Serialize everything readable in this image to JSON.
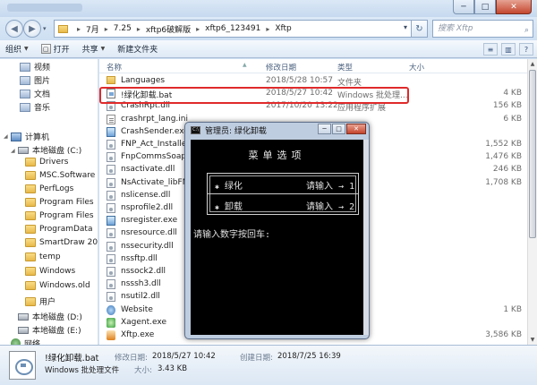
{
  "window": {
    "controls": {
      "minimize": "─",
      "maximize": "□",
      "close": "✕"
    }
  },
  "nav": {
    "back": "◀",
    "forward": "▶",
    "dropdown": "▾",
    "refresh": "↻"
  },
  "address": {
    "segments": [
      "7月",
      "7.25",
      "xftp6破解版",
      "xftp6_123491",
      "Xftp"
    ],
    "separator": "▸",
    "history": "▾"
  },
  "search": {
    "placeholder": "搜索 Xftp",
    "icon": "search-icon"
  },
  "toolbar": {
    "organize": "组织",
    "open": "打开",
    "share": "共享",
    "new_folder": "新建文件夹",
    "view_btn": "≡",
    "pane_btn": "▥",
    "help_btn": "?"
  },
  "sidebar": {
    "items": [
      {
        "label": "视频",
        "icon": "folder-icon"
      },
      {
        "label": "图片",
        "icon": "folder-icon"
      },
      {
        "label": "文档",
        "icon": "folder-icon"
      },
      {
        "label": "音乐",
        "icon": "folder-icon"
      },
      {
        "label": "计算机",
        "icon": "computer-icon"
      },
      {
        "label": "本地磁盘 (C:)",
        "icon": "drive-icon"
      },
      {
        "label": "Drivers",
        "icon": "folder-icon"
      },
      {
        "label": "MSC.Software",
        "icon": "folder-icon"
      },
      {
        "label": "PerfLogs",
        "icon": "folder-icon"
      },
      {
        "label": "Program Files",
        "icon": "folder-icon"
      },
      {
        "label": "Program Files",
        "icon": "folder-icon"
      },
      {
        "label": "ProgramData",
        "icon": "folder-icon"
      },
      {
        "label": "SmartDraw 20",
        "icon": "folder-icon"
      },
      {
        "label": "temp",
        "icon": "folder-icon"
      },
      {
        "label": "Windows",
        "icon": "folder-icon"
      },
      {
        "label": "Windows.old",
        "icon": "folder-icon"
      },
      {
        "label": "用户",
        "icon": "folder-icon"
      },
      {
        "label": "本地磁盘 (D:)",
        "icon": "drive-icon"
      },
      {
        "label": "本地磁盘 (E:)",
        "icon": "drive-icon"
      },
      {
        "label": "网络",
        "icon": "network-icon"
      }
    ]
  },
  "columns": {
    "name": "名称",
    "modified": "修改日期",
    "type": "类型",
    "size": "大小"
  },
  "files": [
    {
      "name": "Languages",
      "date": "2018/5/28 10:57",
      "type": "文件夹",
      "size": "",
      "icon": "folder"
    },
    {
      "name": "!绿化卸载.bat",
      "date": "2018/5/27 10:42",
      "type": "Windows 批处理...",
      "size": "4 KB",
      "icon": "bat"
    },
    {
      "name": "CrashRpt.dll",
      "date": "2017/10/20 13:22",
      "type": "应用程序扩展",
      "size": "156 KB",
      "icon": "dll"
    },
    {
      "name": "crashrpt_lang.ini",
      "date": "",
      "type": "",
      "size": "6 KB",
      "icon": "ini"
    },
    {
      "name": "CrashSender.exe",
      "date": "",
      "type": "",
      "size": "",
      "icon": "exe"
    },
    {
      "name": "FNP_Act_Installer.dl",
      "date": "",
      "type": "",
      "size": "1,552 KB",
      "icon": "dll"
    },
    {
      "name": "FnpCommsSoap.dll",
      "date": "",
      "type": "",
      "size": "1,476 KB",
      "icon": "dll"
    },
    {
      "name": "nsactivate.dll",
      "date": "",
      "type": "",
      "size": "246 KB",
      "icon": "dll"
    },
    {
      "name": "NsActivate_libFNP.d",
      "date": "",
      "type": "",
      "size": "1,708 KB",
      "icon": "dll"
    },
    {
      "name": "nslicense.dll",
      "date": "",
      "type": "",
      "size": "",
      "icon": "dll"
    },
    {
      "name": "nsprofile2.dll",
      "date": "",
      "type": "",
      "size": "",
      "icon": "dll"
    },
    {
      "name": "nsregister.exe",
      "date": "",
      "type": "",
      "size": "",
      "icon": "exe"
    },
    {
      "name": "nsresource.dll",
      "date": "",
      "type": "",
      "size": "",
      "icon": "dll"
    },
    {
      "name": "nssecurity.dll",
      "date": "",
      "type": "",
      "size": "",
      "icon": "dll"
    },
    {
      "name": "nssftp.dll",
      "date": "",
      "type": "",
      "size": "",
      "icon": "dll"
    },
    {
      "name": "nssock2.dll",
      "date": "",
      "type": "",
      "size": "",
      "icon": "dll"
    },
    {
      "name": "nsssh3.dll",
      "date": "",
      "type": "",
      "size": "",
      "icon": "dll"
    },
    {
      "name": "nsutil2.dll",
      "date": "",
      "type": "",
      "size": "",
      "icon": "dll"
    },
    {
      "name": "Website",
      "date": "",
      "type": "",
      "size": "1 KB",
      "icon": "web"
    },
    {
      "name": "Xagent.exe",
      "date": "",
      "type": "",
      "size": "",
      "icon": "xag"
    },
    {
      "name": "Xftp.exe",
      "date": "",
      "type": "",
      "size": "3,586 KB",
      "icon": "xftp"
    }
  ],
  "details": {
    "name": "!绿化卸载.bat",
    "type": "Windows 批处理文件",
    "modified_label": "修改日期:",
    "modified": "2018/5/27 10:42",
    "created_label": "创建日期:",
    "created": "2018/7/25 16:39",
    "size_label": "大小:",
    "size": "3.43 KB"
  },
  "console": {
    "title": "管理员: 绿化卸载",
    "icon_text": "C:\\",
    "controls": {
      "minimize": "─",
      "maximize": "□",
      "close": "✕"
    },
    "menu_title": "菜单选项",
    "options": [
      {
        "star": "✱",
        "label": "绿化",
        "hint": "请输入",
        "arrow": "→",
        "key": "1"
      },
      {
        "star": "✱",
        "label": "卸载",
        "hint": "请输入",
        "arrow": "→",
        "key": "2"
      }
    ],
    "prompt": "请输入数字按回车:"
  }
}
